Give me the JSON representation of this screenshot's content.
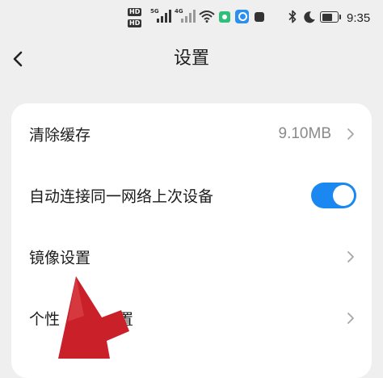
{
  "status_bar": {
    "hd1": "HD",
    "hd2": "HD",
    "sig1_tag": "5G",
    "sig2_tag": "4G",
    "time": "9:35",
    "bluetooth_glyph": "∦",
    "moon_glyph": "☾",
    "battery_level": 0.8,
    "icons": [
      "hd1-icon",
      "hd2-icon",
      "signal-5g-icon",
      "signal-4g-icon",
      "wifi-icon",
      "app-notification-icon",
      "search-app-icon",
      "app-notification-icon-dark",
      "bluetooth-icon",
      "moon-icon",
      "battery-icon"
    ]
  },
  "header": {
    "title": "设置",
    "back_icon": "chevron-left-icon"
  },
  "settings": {
    "items": [
      {
        "label": "清除缓存",
        "value": "9.10MB",
        "control": "chevron"
      },
      {
        "label": "自动连接同一网络上次设备",
        "control": "toggle",
        "enabled": true
      },
      {
        "label": "镜像设置",
        "control": "chevron"
      },
      {
        "label": "个性",
        "label_tail": "置",
        "control": "chevron"
      }
    ]
  },
  "colors": {
    "background": "#efefef",
    "card": "#ffffff",
    "accent": "#1a88f0",
    "secondary_text": "#8a8a8a",
    "arrow": "#c9202a"
  }
}
